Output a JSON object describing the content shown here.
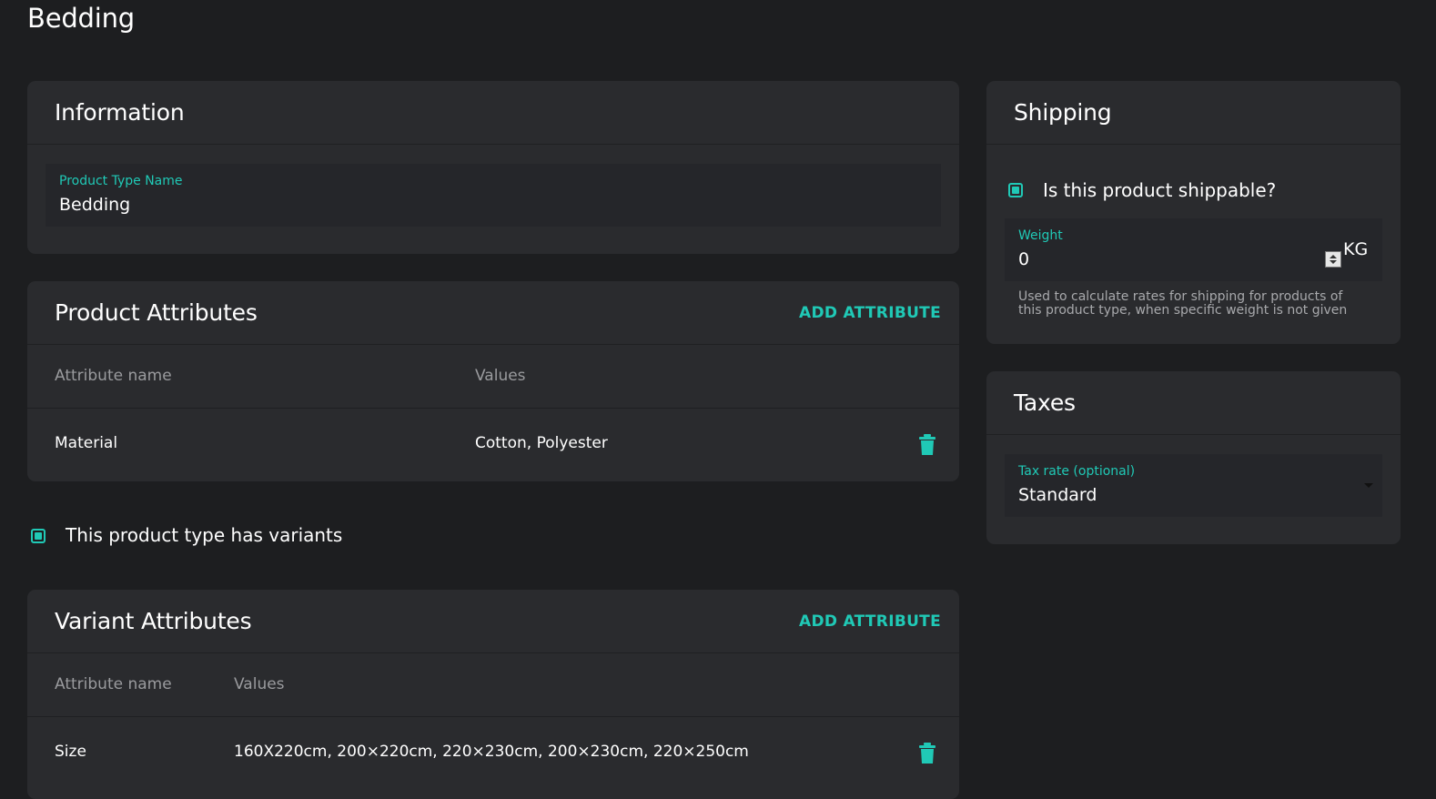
{
  "page": {
    "title": "Bedding"
  },
  "information": {
    "title": "Information",
    "name_field": {
      "label": "Product Type Name",
      "value": "Bedding"
    }
  },
  "product_attributes": {
    "title": "Product Attributes",
    "add_label": "ADD ATTRIBUTE",
    "columns": [
      "Attribute name",
      "Values"
    ],
    "rows": [
      {
        "name": "Material",
        "values": "Cotton, Polyester"
      }
    ]
  },
  "variants_checkbox": {
    "label": "This product type has variants",
    "checked": true
  },
  "variant_attributes": {
    "title": "Variant Attributes",
    "add_label": "ADD ATTRIBUTE",
    "columns": [
      "Attribute name",
      "Values"
    ],
    "rows": [
      {
        "name": "Size",
        "values": "160X220cm, 200×220cm, 220×230cm, 200×230cm, 220×250cm"
      }
    ]
  },
  "shipping": {
    "title": "Shipping",
    "shippable_label": "Is this product shippable?",
    "shippable_checked": true,
    "weight_field": {
      "label": "Weight",
      "value": "0",
      "unit": "KG"
    },
    "helper": "Used to calculate rates for shipping for products of this product type, when specific weight is not given"
  },
  "taxes": {
    "title": "Taxes",
    "tax_field": {
      "label": "Tax rate (optional)",
      "value": "Standard"
    }
  },
  "colors": {
    "accent": "#20c9b6",
    "background": "#1d1e20",
    "card": "#2a2b2e",
    "input": "#25262a"
  },
  "icons": {
    "delete": "trash-icon",
    "checkbox": "checkbox-checked-icon",
    "spinner": "number-spinner-icon",
    "dropdown": "chevron-down-icon"
  }
}
